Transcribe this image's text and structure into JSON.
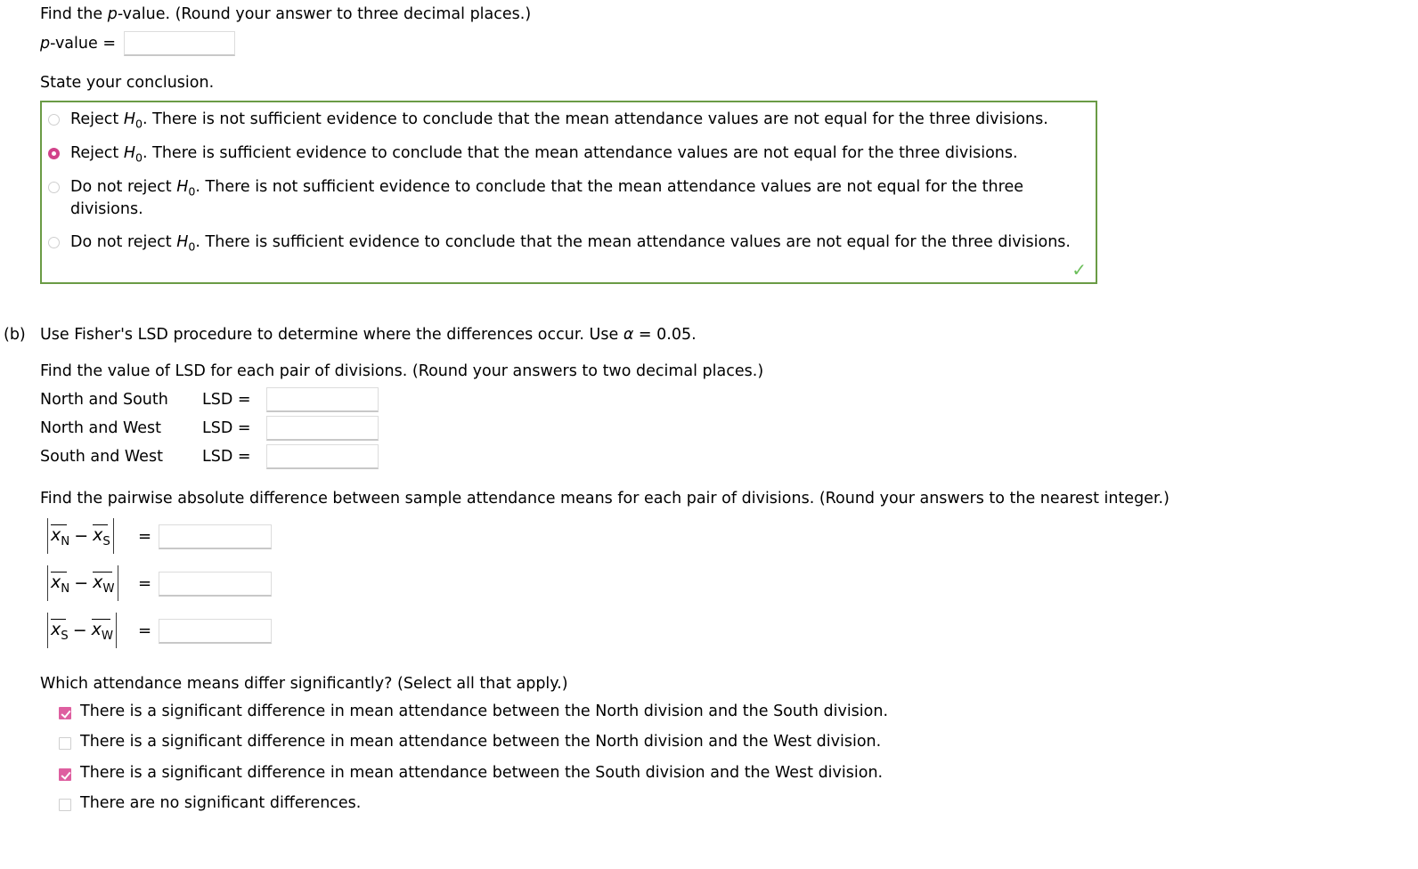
{
  "part_a": {
    "pvalue_prompt": "Find the ",
    "pvalue_prompt_italic": "p",
    "pvalue_prompt_rest": "-value. (Round your answer to three decimal places.)",
    "pvalue_label_italic": "p",
    "pvalue_label_rest": "-value  =",
    "pvalue_input_value": "",
    "conclusion_prompt": "State your conclusion.",
    "correct_icon": "check-icon",
    "options": [
      {
        "prefix": "Reject ",
        "symbol": "H",
        "subscript": "0",
        "text": ". There is not sufficient evidence to conclude that the mean attendance values are not equal for the three divisions.",
        "selected": false
      },
      {
        "prefix": "Reject ",
        "symbol": "H",
        "subscript": "0",
        "text": ". There is sufficient evidence to conclude that the mean attendance values are not equal for the three divisions.",
        "selected": true
      },
      {
        "prefix": "Do not reject ",
        "symbol": "H",
        "subscript": "0",
        "text": ". There is not sufficient evidence to conclude that the mean attendance values are not equal for the three divisions.",
        "selected": false
      },
      {
        "prefix": "Do not reject ",
        "symbol": "H",
        "subscript": "0",
        "text": ". There is sufficient evidence to conclude that the mean attendance values are not equal for the three divisions.",
        "selected": false
      }
    ]
  },
  "part_b": {
    "label": "(b)",
    "prompt_before_alpha": "Use Fisher's LSD procedure to determine where the differences occur. Use ",
    "alpha_symbol": "α",
    "prompt_after_alpha": " = 0.05.",
    "lsd_instruction": "Find the value of LSD for each pair of divisions. (Round your answers to two decimal places.)",
    "lsd_rows": [
      {
        "pair": "North and South",
        "lsd_label": "LSD  =",
        "value": ""
      },
      {
        "pair": "North and West",
        "lsd_label": "LSD  =",
        "value": ""
      },
      {
        "pair": "South and West",
        "lsd_label": "LSD  =",
        "value": ""
      }
    ],
    "pairwise_instruction": "Find the pairwise absolute difference between sample attendance means for each pair of divisions. (Round your answers to the nearest integer.)",
    "pairwise_rows": [
      {
        "x1": "x",
        "sub1": "N",
        "x2": "x",
        "sub2": "S",
        "eq": "=",
        "value": ""
      },
      {
        "x1": "x",
        "sub1": "N",
        "x2": "x",
        "sub2": "W",
        "eq": "=",
        "value": ""
      },
      {
        "x1": "x",
        "sub1": "S",
        "x2": "x",
        "sub2": "W",
        "eq": "=",
        "value": ""
      }
    ],
    "minus_symbol": "−",
    "select_prompt": "Which attendance means differ significantly? (Select all that apply.)",
    "checkbox_options": [
      {
        "text": "There is a significant difference in mean attendance between the North division and the South division.",
        "checked": true
      },
      {
        "text": "There is a significant difference in mean attendance between the North division and the West division.",
        "checked": false
      },
      {
        "text": "There is a significant difference in mean attendance between the South division and the West division.",
        "checked": true
      },
      {
        "text": "There are no significant differences.",
        "checked": false
      }
    ]
  },
  "colors": {
    "accent_pink": "#de5fa0",
    "radio_pink": "#d1428a",
    "box_green": "#6a9b45",
    "check_green": "#6cbf5b"
  }
}
